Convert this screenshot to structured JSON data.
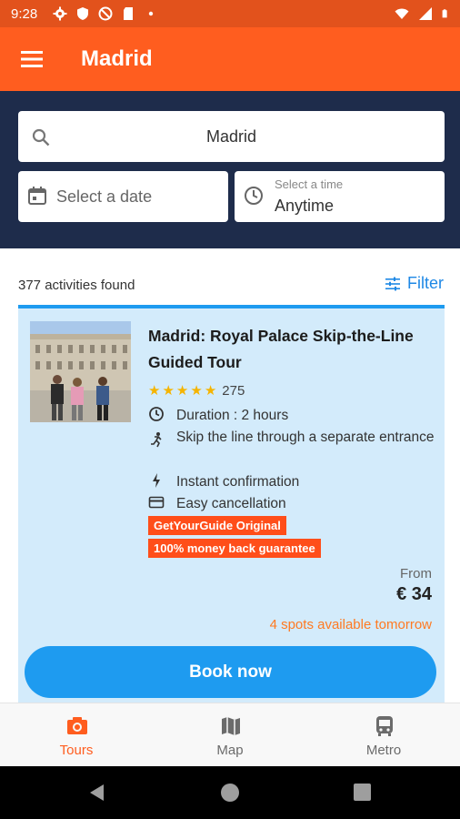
{
  "status_bar": {
    "time": "9:28",
    "left_icons": [
      "gear-icon",
      "shield-icon",
      "no-sim-icon",
      "sd-card-icon",
      "dot-icon"
    ],
    "right_icons": [
      "wifi-icon",
      "signal-icon",
      "battery-icon"
    ]
  },
  "app_bar": {
    "title": "Madrid",
    "menu_icon": "hamburger-menu-icon"
  },
  "search": {
    "value": "Madrid",
    "date_placeholder": "Select a date",
    "time_caption": "Select a time",
    "time_value": "Anytime"
  },
  "results": {
    "count_text": "377 activities found",
    "filter_label": "Filter"
  },
  "card": {
    "title": "Madrid: Royal Palace Skip-the-Line Guided Tour",
    "rating_stars": 5,
    "review_count": "275",
    "features": [
      {
        "icon": "clock-icon",
        "text": "Duration : 2 hours"
      },
      {
        "icon": "runner-icon",
        "text": "Skip the line through a separate entrance"
      },
      {
        "icon": "lightning-icon",
        "text": "Instant confirmation"
      },
      {
        "icon": "credit-card-icon",
        "text": "Easy cancellation"
      }
    ],
    "tags": [
      "GetYourGuide Original",
      "100% money back guarantee"
    ],
    "from_label": "From",
    "price": "€ 34",
    "availability": "4 spots available tomorrow",
    "book_label": "Book now"
  },
  "bottom_nav": {
    "items": [
      {
        "label": "Tours",
        "icon": "camera-icon",
        "active": true
      },
      {
        "label": "Map",
        "icon": "map-icon",
        "active": false
      },
      {
        "label": "Metro",
        "icon": "bus-icon",
        "active": false
      }
    ]
  },
  "colors": {
    "status_bar": "#e2521c",
    "app_bar": "#ff5d1f",
    "search_panel": "#1e2c4b",
    "accent_blue": "#1e9bf0",
    "card_bg": "#d3ebfb",
    "tag_bg": "#ff4e1a",
    "availability": "#ff7a21",
    "active_nav": "#ff5d1f",
    "inactive_nav": "#6b6b6b"
  }
}
